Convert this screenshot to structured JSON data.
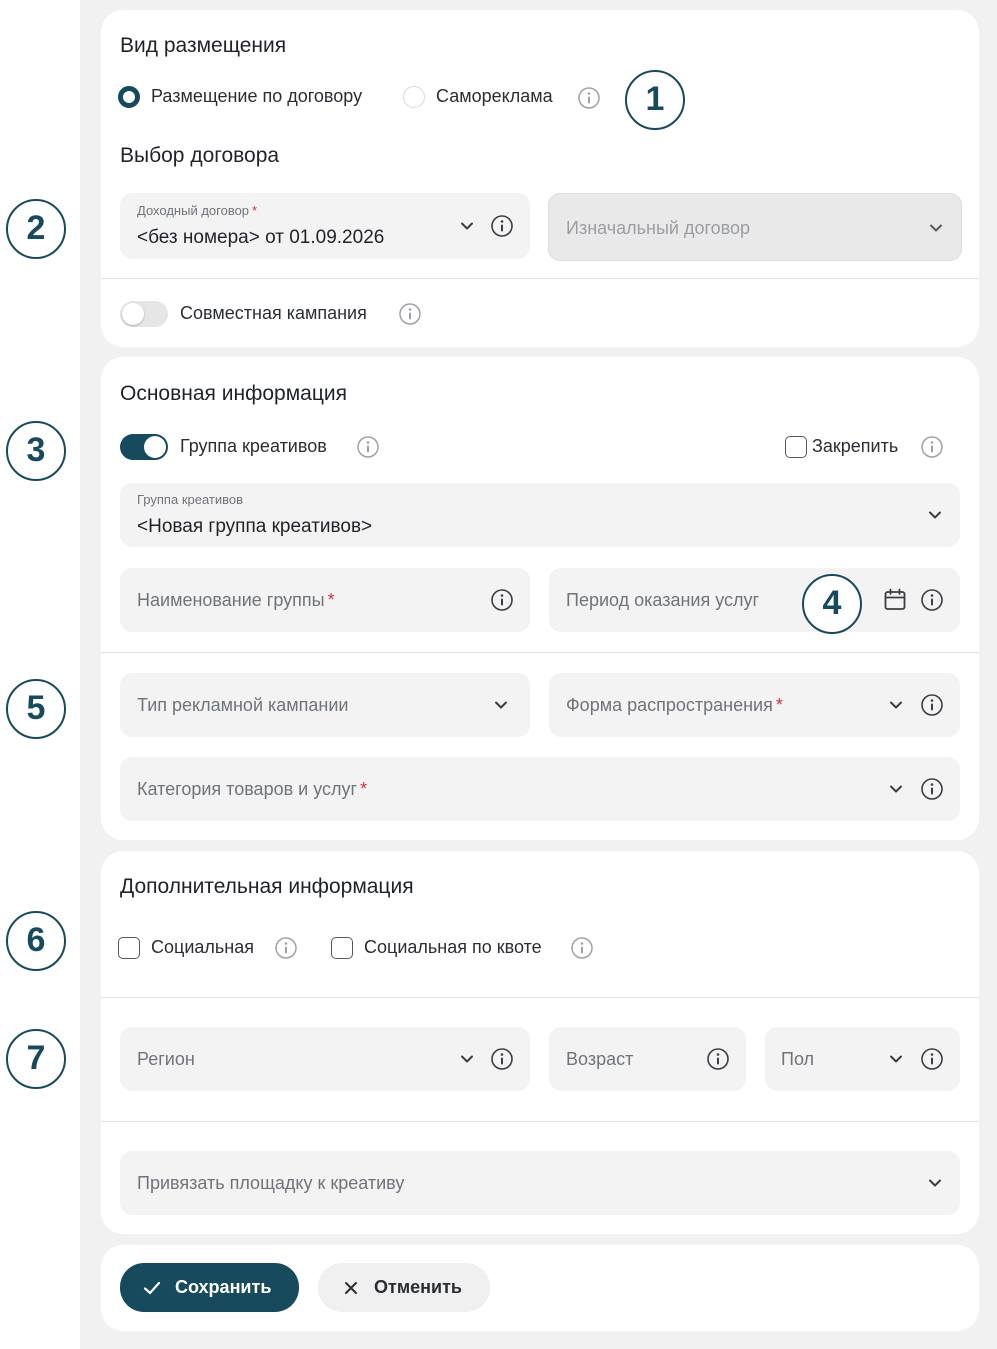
{
  "placement": {
    "title": "Вид размещения",
    "options": [
      {
        "label": "Размещение по договору",
        "selected": true
      },
      {
        "label": "Самореклама",
        "selected": false
      }
    ]
  },
  "contract": {
    "title": "Выбор договора",
    "income_label": "Доходный договор",
    "income_value": "<без номера> от 01.09.2026",
    "initial_placeholder": "Изначальный договор",
    "joint_label": "Совместная кампания",
    "joint_enabled": false
  },
  "main_info": {
    "title": "Основная информация",
    "creative_group_toggle_label": "Группа креативов",
    "creative_group_enabled": true,
    "pin_label": "Закрепить",
    "creative_group_field_label": "Группа креативов",
    "creative_group_value": "<Новая группа креативов>",
    "group_name_placeholder": "Наименование группы",
    "service_period_placeholder": "Период оказания услуг",
    "campaign_type_placeholder": "Тип рекламной кампании",
    "distribution_form_placeholder": "Форма распространения",
    "category_placeholder": "Категория товаров и услуг"
  },
  "extra_info": {
    "title": "Дополнительная информация",
    "social_label": "Социальная",
    "social_quota_label": "Социальная по квоте",
    "region_placeholder": "Регион",
    "age_placeholder": "Возраст",
    "gender_placeholder": "Пол",
    "bind_site_placeholder": "Привязать площадку к креативу"
  },
  "actions": {
    "save_label": "Сохранить",
    "cancel_label": "Отменить"
  },
  "annotations": [
    "1",
    "2",
    "3",
    "4",
    "5",
    "6",
    "7"
  ],
  "colors": {
    "accent": "#164a5c",
    "required": "#d0343a",
    "page_background": "#f1f1f1",
    "field_background": "#f3f3f3"
  },
  "required_mark": "*"
}
